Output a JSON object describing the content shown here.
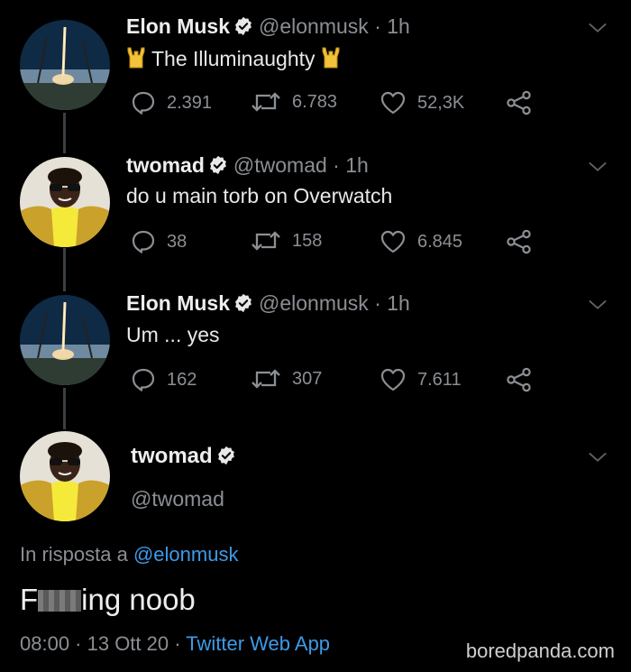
{
  "tweets": [
    {
      "name": "Elon Musk",
      "handle": "@elonmusk",
      "time": "· 1h",
      "text": "The Illuminaughty",
      "replies": "2.391",
      "retweets": "6.783",
      "likes": "52,3K",
      "avatar": "rocket-launch-avatar"
    },
    {
      "name": "twomad",
      "handle": "@twomad",
      "time": "· 1h",
      "text": "do u main torb on Overwatch",
      "replies": "38",
      "retweets": "158",
      "likes": "6.845",
      "avatar": "person-sunglasses-avatar"
    },
    {
      "name": "Elon Musk",
      "handle": "@elonmusk",
      "time": "· 1h",
      "text": "Um ... yes",
      "replies": "162",
      "retweets": "307",
      "likes": "7.611",
      "avatar": "rocket-launch-avatar"
    }
  ],
  "main_tweet": {
    "name": "twomad",
    "handle": "@twomad",
    "reply_prefix": "In risposta a",
    "reply_to": "@elonmusk",
    "text_start": "F",
    "text_end": "ing noob",
    "timestamp": "08:00 · 13 Ott 20 ·",
    "source": "Twitter Web App"
  },
  "watermark": "boredpanda.com",
  "colors": {
    "background": "#000000",
    "link": "#3d9ae8",
    "muted": "#8b8f94",
    "horns": "#f2c23a"
  },
  "icons": [
    "reply-icon",
    "retweet-icon",
    "like-icon",
    "share-icon",
    "verified-badge-icon",
    "chevron-down-icon",
    "sign-of-horns-icon"
  ]
}
